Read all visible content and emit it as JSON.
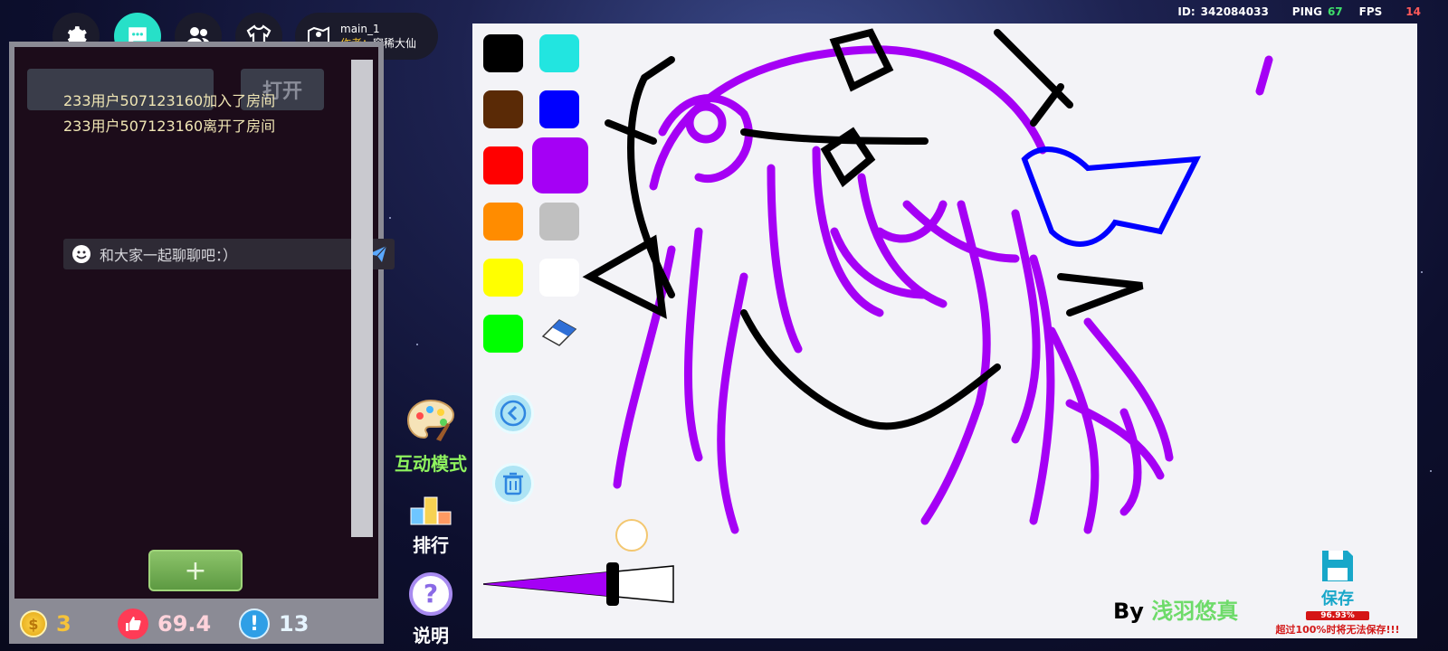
{
  "hud": {
    "id_label": "ID:",
    "id_value": "342084033",
    "ping_label": "PING",
    "ping_value": "67",
    "fps_label": "FPS",
    "fps_value": "14"
  },
  "map": {
    "name": "main_1",
    "author_label": "作者：",
    "author_name": "窜稀大仙"
  },
  "chat": {
    "messages": [
      "233用户507123160加入了房间",
      "233用户507123160离开了房间"
    ],
    "ghost_button": "打开",
    "placeholder": "和大家一起聊聊吧：）"
  },
  "stats": {
    "coins": "3",
    "likes": "69.4",
    "reports": "13"
  },
  "side_buttons": {
    "interactive_mode": "互动模式",
    "ranking": "排行",
    "help": "说明"
  },
  "canvas": {
    "byline_prefix": "By",
    "byline_name": "浅羽悠真",
    "save_label": "保存",
    "save_progress": "96.93%",
    "save_progress_fraction": 0.9693,
    "save_warning": "超过100%时将无法保存!!!",
    "palette": [
      "#000000",
      "#22e5e0",
      "#5a2a06",
      "#0000ff",
      "#ff0000",
      "#a500f5",
      "#ff8c00",
      "#c0c0c0",
      "#ffff00",
      "#ffffff",
      "#00ff00"
    ],
    "selected_color": "#a500f5"
  }
}
